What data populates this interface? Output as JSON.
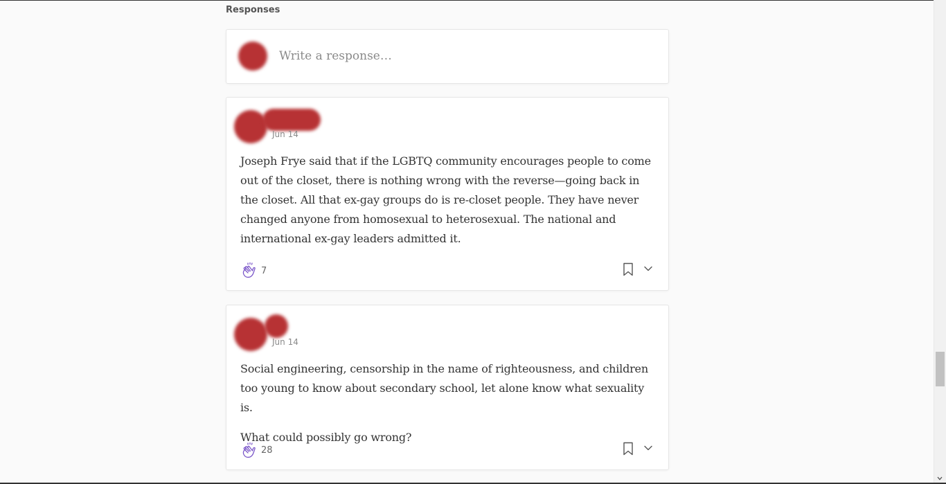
{
  "responses": {
    "title": "Responses",
    "compose_placeholder": "Write a response…",
    "items": [
      {
        "date": "Jun 14",
        "paragraphs": [
          "Joseph Frye said that if the LGBTQ community encourages people to come out of the closet, there is nothing wrong with the reverse—going back in the closet. All that ex-gay groups do is re-closet people. They have never changed anyone from homosexual to heterosexual. The national and international ex-gay leaders admitted it."
        ],
        "claps": "7"
      },
      {
        "date": "Jun 14",
        "paragraphs": [
          "Social engineering, censorship in the name of righteousness, and children too young to know about secondary school, let alone know what sexuality is.",
          "What could possibly go wrong?"
        ],
        "claps": "28"
      }
    ]
  },
  "icons": {
    "clap": "clap-icon",
    "bookmark": "bookmark-icon",
    "more": "chevron-down-icon"
  },
  "colors": {
    "redaction": "#b73234",
    "clap": "#7b57c9"
  }
}
